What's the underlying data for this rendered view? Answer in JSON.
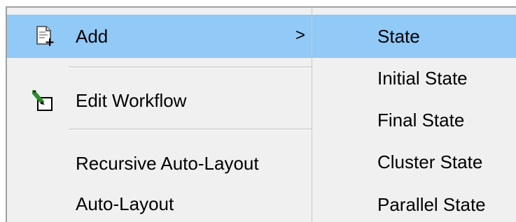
{
  "context_menu": {
    "items": [
      {
        "label": "Add",
        "icon": "add-page-icon",
        "arrow": ">"
      },
      {
        "label": "Edit Workflow",
        "icon": "edit-pencil-icon"
      },
      {
        "label": "Recursive Auto-Layout"
      },
      {
        "label": "Auto-Layout"
      }
    ]
  },
  "submenu": {
    "items": [
      {
        "label": "State"
      },
      {
        "label": "Initial State"
      },
      {
        "label": "Final State"
      },
      {
        "label": "Cluster State"
      },
      {
        "label": "Parallel State"
      }
    ]
  },
  "colors": {
    "menu_background": "#f0f0f0",
    "highlight": "#91c9f7",
    "border": "#a0a0a0"
  }
}
